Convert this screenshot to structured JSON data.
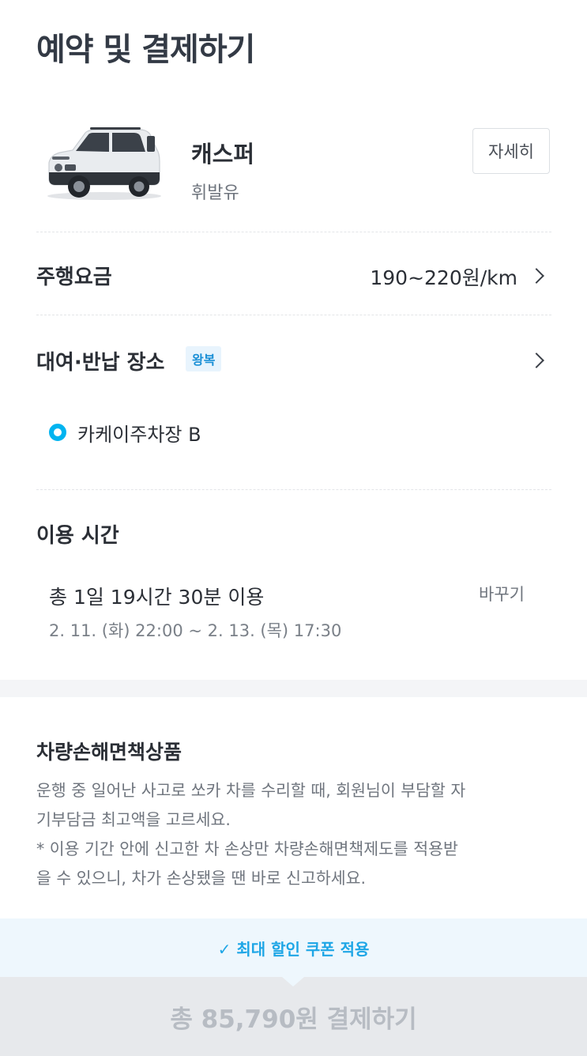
{
  "header": {
    "title": "예약 및 결제하기"
  },
  "car": {
    "name": "캐스퍼",
    "fuel": "휘발유",
    "detail_label": "자세히",
    "body_color": "#e9ecef"
  },
  "fee": {
    "label": "주행요금",
    "value": "190~220원/km"
  },
  "location": {
    "label": "대여·반납 장소",
    "badge": "왕복",
    "place": "카케이주차장 B",
    "dot_color": "#00b4f0"
  },
  "usage": {
    "label": "이용 시간",
    "total": "총 1일 19시간 30분 이용",
    "range": "2. 11. (화) 22:00 ~ 2. 13. (목) 17:30",
    "change_label": "바꾸기"
  },
  "insurance": {
    "title": "차량손해면책상품",
    "description_lines": [
      "운행 중 일어난 사고로 쏘카 차를 수리할 때, 회원님이 부담할 자",
      "기부담금 최고액을 고르세요.",
      "* 이용 기간 안에 신고한 차 손상만 차량손해면책제도를 적용받",
      "을 수 있으니, 차가 손상됐을 땐 바로 신고하세요."
    ]
  },
  "coupon": {
    "label": "✓ 최대 할인 쿠폰 적용",
    "color": "#1ea6e6"
  },
  "payment": {
    "button_label": "총 85,790원 결제하기"
  }
}
